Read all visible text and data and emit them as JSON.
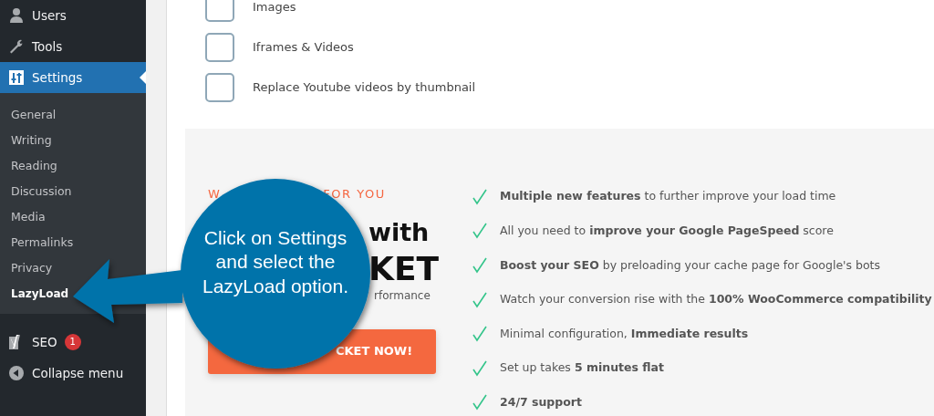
{
  "sidebar": {
    "items": [
      {
        "label": "Users",
        "selected": false
      },
      {
        "label": "Tools",
        "selected": false
      },
      {
        "label": "Settings",
        "selected": true,
        "children": [
          {
            "label": "General",
            "selected": false
          },
          {
            "label": "Writing",
            "selected": false
          },
          {
            "label": "Reading",
            "selected": false
          },
          {
            "label": "Discussion",
            "selected": false
          },
          {
            "label": "Media",
            "selected": false
          },
          {
            "label": "Permalinks",
            "selected": false
          },
          {
            "label": "Privacy",
            "selected": false
          },
          {
            "label": "LazyLoad",
            "selected": true
          }
        ]
      },
      {
        "label": "SEO",
        "selected": false,
        "badge": "1"
      },
      {
        "label": "Collapse menu",
        "selected": false
      }
    ]
  },
  "options": [
    {
      "label": "Images",
      "checked": false
    },
    {
      "label": "Iframes & Videos",
      "checked": false
    },
    {
      "label": "Replace Youtube videos by thumbnail",
      "checked": false
    }
  ],
  "promo": {
    "eyebrow_parts": [
      "W",
      "FOR YOU"
    ],
    "heading_part": "with",
    "logo_part": "KET",
    "tagline_part": "rformance",
    "button": "CKET NOW!",
    "features": [
      "**Multiple new features** to further improve your load time",
      "All you need to **improve your Google PageSpeed** score",
      "**Boost your SEO** by preloading your cache page for Google's bots",
      "Watch your conversion rise with the **100% WooCommerce compatibility**",
      "Minimal configuration, **Immediate results**",
      "Set up takes **5 minutes flat**",
      "**24/7 support**"
    ]
  },
  "callout": {
    "text": "Click on Settings and select the LazyLoad option."
  }
}
